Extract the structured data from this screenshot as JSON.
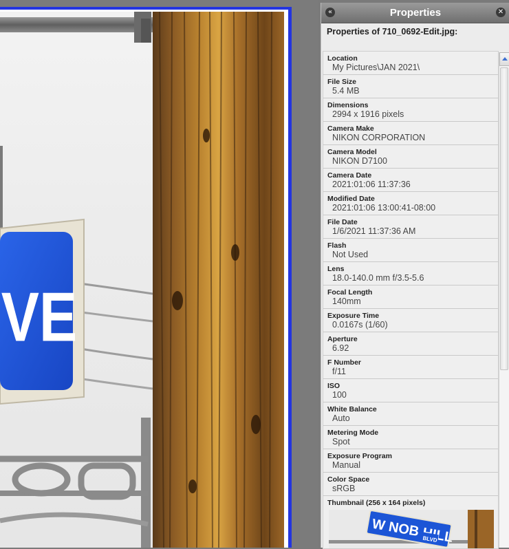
{
  "panel": {
    "title": "Properties",
    "subtitle": "Properties of 710_0692-Edit.jpg:",
    "collapse_icon": "double-chevron-left-icon",
    "close_icon": "close-icon"
  },
  "properties": [
    {
      "label": "Location",
      "value": "My Pictures\\JAN 2021\\"
    },
    {
      "label": "File Size",
      "value": "5.4 MB"
    },
    {
      "label": "Dimensions",
      "value": "2994 x 1916 pixels"
    },
    {
      "label": "Camera Make",
      "value": "NIKON CORPORATION"
    },
    {
      "label": "Camera Model",
      "value": "NIKON D7100"
    },
    {
      "label": "Camera Date",
      "value": "2021:01:06 11:37:36"
    },
    {
      "label": "Modified Date",
      "value": "2021:01:06 13:00:41-08:00"
    },
    {
      "label": "File Date",
      "value": "1/6/2021 11:37:36 AM"
    },
    {
      "label": "Flash",
      "value": "Not Used"
    },
    {
      "label": "Lens",
      "value": "18.0-140.0 mm f/3.5-5.6"
    },
    {
      "label": "Focal Length",
      "value": "140mm"
    },
    {
      "label": "Exposure Time",
      "value": "0.0167s (1/60)"
    },
    {
      "label": "Aperture",
      "value": "6.92"
    },
    {
      "label": "F Number",
      "value": "f/11"
    },
    {
      "label": "ISO",
      "value": "100"
    },
    {
      "label": "White Balance",
      "value": "Auto"
    },
    {
      "label": "Metering Mode",
      "value": "Spot"
    },
    {
      "label": "Exposure Program",
      "value": "Manual"
    },
    {
      "label": "Color Space",
      "value": "sRGB"
    }
  ],
  "thumbnail": {
    "label": "Thumbnail (256 x 164 pixels)",
    "sign_text": "W NOB HILL",
    "sign_suffix": "BLVD"
  },
  "photo": {
    "sign_text": "VE"
  },
  "colors": {
    "selection_border": "#2435e0",
    "sign_blue": "#1c55d6",
    "scroll_arrow": "#3d6fd1"
  }
}
